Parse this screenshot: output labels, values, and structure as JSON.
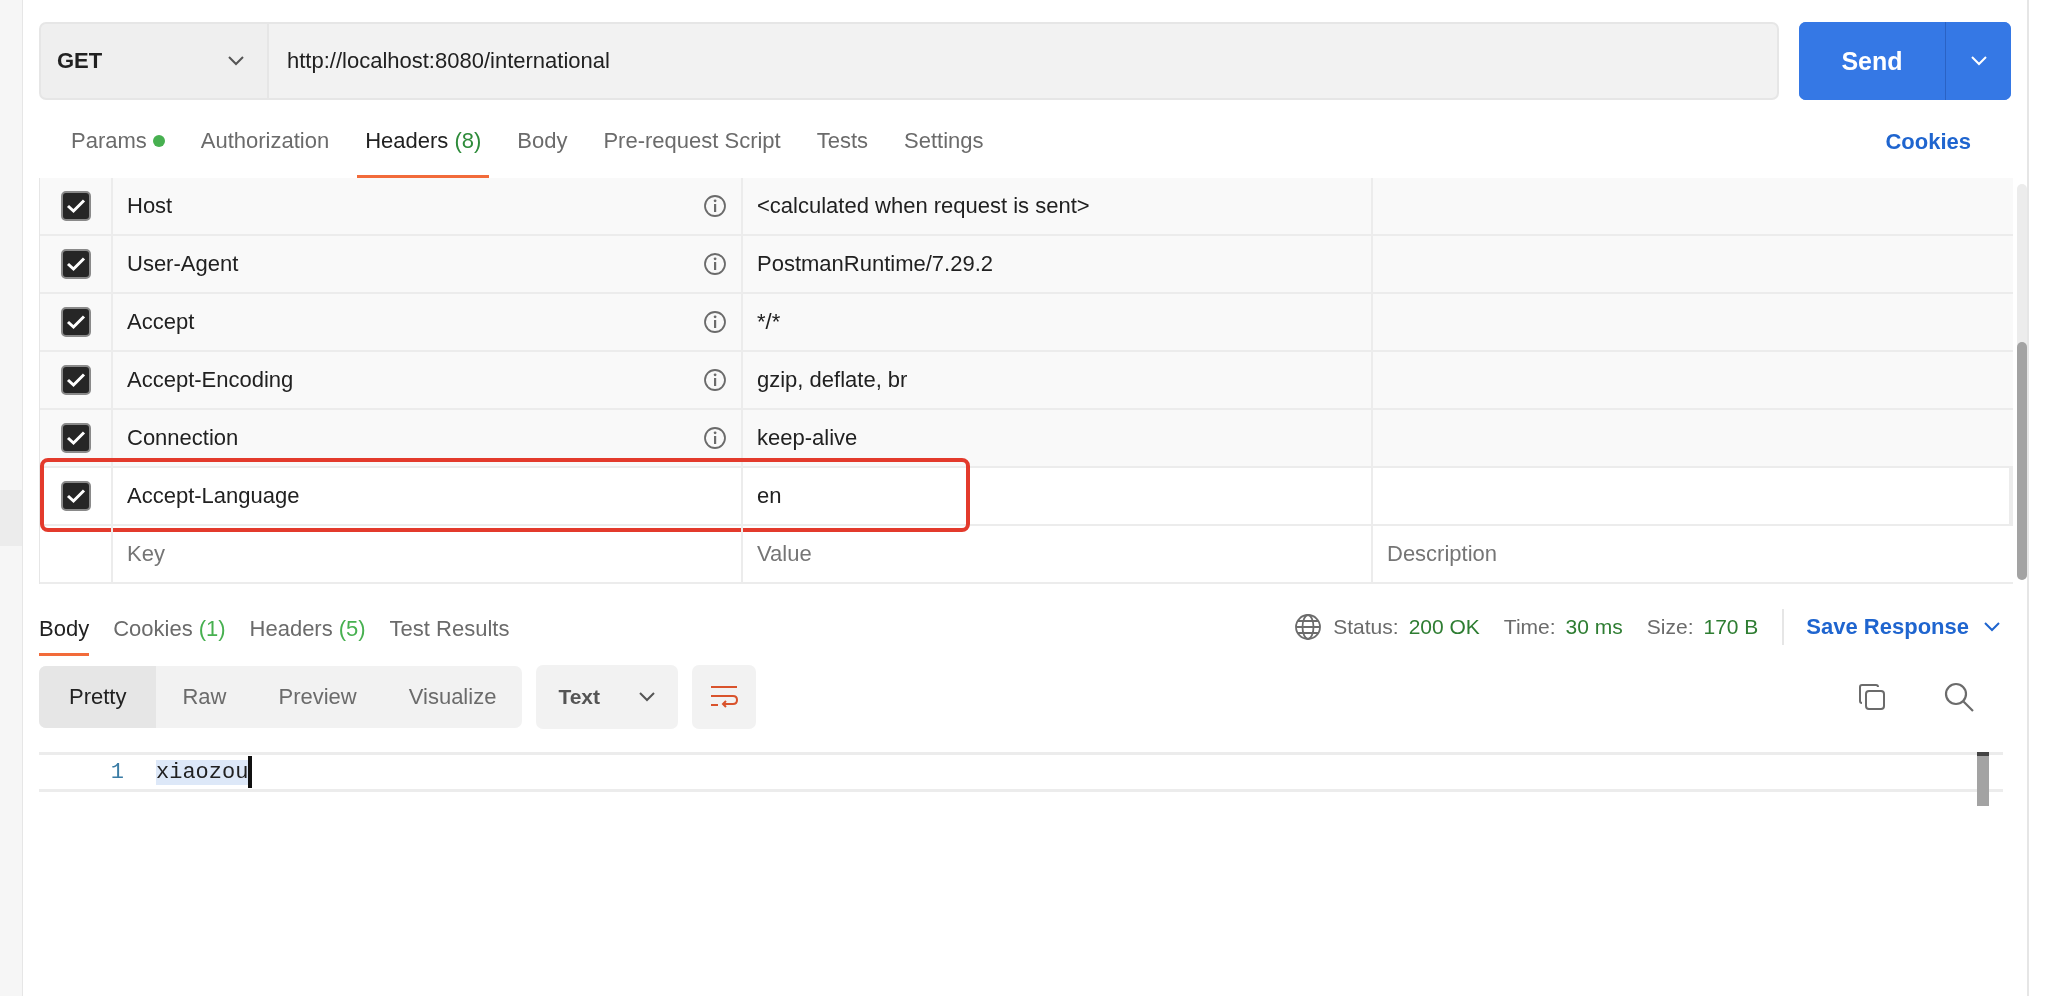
{
  "request": {
    "method": "GET",
    "url": "http://localhost:8080/international",
    "send": "Send"
  },
  "request_tabs": [
    {
      "label": "Params",
      "dot": true,
      "selected": false
    },
    {
      "label": "Authorization",
      "selected": false
    },
    {
      "label": "Headers",
      "count": "(8)",
      "selected": true
    },
    {
      "label": "Body",
      "selected": false
    },
    {
      "label": "Pre-request Script",
      "selected": false
    },
    {
      "label": "Tests",
      "selected": false
    },
    {
      "label": "Settings",
      "selected": false
    }
  ],
  "cookies_link": "Cookies",
  "headers": {
    "rows": [
      {
        "checked": true,
        "kind": "auto",
        "key": "Host",
        "value": "<calculated when request is sent>",
        "highlighted": false
      },
      {
        "checked": true,
        "kind": "auto",
        "key": "User-Agent",
        "value": "PostmanRuntime/7.29.2",
        "highlighted": false
      },
      {
        "checked": true,
        "kind": "auto",
        "key": "Accept",
        "value": "*/*",
        "highlighted": false
      },
      {
        "checked": true,
        "kind": "auto",
        "key": "Accept-Encoding",
        "value": "gzip, deflate, br",
        "highlighted": false
      },
      {
        "checked": true,
        "kind": "auto",
        "key": "Connection",
        "value": "keep-alive",
        "highlighted": false
      },
      {
        "checked": true,
        "kind": "custom",
        "key": "Accept-Language",
        "value": "en",
        "highlighted": true
      }
    ],
    "new_row": {
      "key_placeholder": "Key",
      "value_placeholder": "Value",
      "description_placeholder": "Description"
    }
  },
  "response": {
    "tabs": [
      {
        "label": "Body",
        "selected": true
      },
      {
        "label": "Cookies",
        "count": "(1)",
        "selected": false
      },
      {
        "label": "Headers",
        "count": "(5)",
        "selected": false
      },
      {
        "label": "Test Results",
        "selected": false
      }
    ],
    "status": {
      "label": "Status:",
      "value": "200 OK"
    },
    "time": {
      "label": "Time:",
      "value": "30 ms"
    },
    "size": {
      "label": "Size:",
      "value": "170 B"
    },
    "save": "Save Response",
    "view_modes": [
      {
        "label": "Pretty",
        "selected": true
      },
      {
        "label": "Raw",
        "selected": false
      },
      {
        "label": "Preview",
        "selected": false
      },
      {
        "label": "Visualize",
        "selected": false
      }
    ],
    "format": "Text",
    "lines": [
      {
        "number": "1",
        "text": "xiaozou"
      }
    ]
  }
}
